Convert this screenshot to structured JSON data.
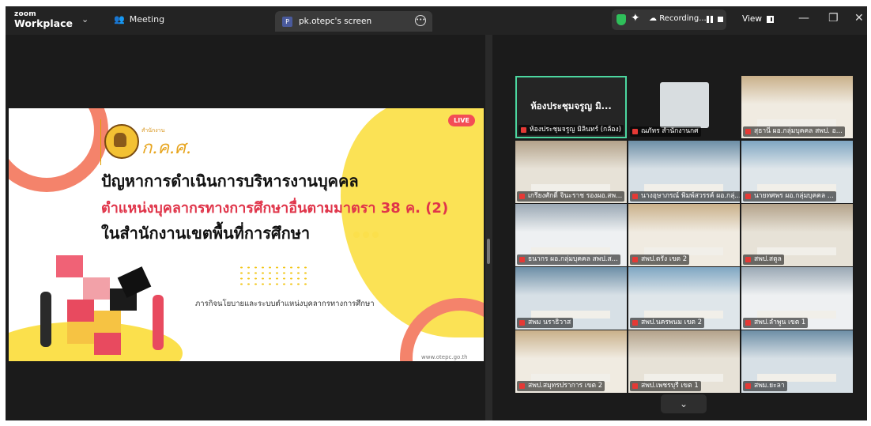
{
  "app": {
    "logo_top": "zoom",
    "logo_bottom": "Workplace",
    "meeting_label": "Meeting",
    "tab_title": "pk.otepc's screen",
    "tab_badge": "P",
    "recording_label": "Recording...",
    "view_label": "View"
  },
  "slide": {
    "live_badge": "LIVE",
    "logo_small": "สำนักงาน",
    "logo_big": "ก.ค.ศ.",
    "title_line1": "ปัญหาการดำเนินการบริหารงานบุคคล",
    "title_line2": "ตำแหน่งบุคลากรทางการศึกษาอื่นตามมาตรา 38 ค. (2)",
    "title_line3": "ในสำนักงานเขตพื้นที่การศึกษา",
    "subtitle": "ภารกิจนโยบายและระบบตำแหน่งบุคลากรทางการศึกษา",
    "url": "www.otepc.go.th"
  },
  "participants": [
    {
      "label": "ห้องประชุมจรูญ มิลินทร์ (กล้อง)",
      "display_name": "ห้องประชุมจรูญ มิ...",
      "active": true
    },
    {
      "label": "ณภัทร สำนักงานกศ",
      "display_name": ""
    },
    {
      "label": "สุธานี ผอ.กลุ่มบุคคล สพป. อ...",
      "display_name": ""
    },
    {
      "label": "เกรียงศักดิ์ จินะราช รองผอ.สพ...",
      "display_name": ""
    },
    {
      "label": "นางอุษาภรณ์ พิมพ์สวรรค์ ผอ.กลุ่...",
      "display_name": ""
    },
    {
      "label": "นายทศพร ผอ.กลุ่มบุคคล ...",
      "display_name": ""
    },
    {
      "label": "ธนากร ผอ.กลุ่มบุคคล สพป.ส...",
      "display_name": ""
    },
    {
      "label": "สพป.ตรัง เขต 2",
      "display_name": ""
    },
    {
      "label": "สพป.สตูล",
      "display_name": ""
    },
    {
      "label": "สพม นราธิวาส",
      "display_name": ""
    },
    {
      "label": "สพป.นครพนม เขต 2",
      "display_name": ""
    },
    {
      "label": "สพป.ลำพูน เขต 1",
      "display_name": ""
    },
    {
      "label": "สพป.สมุทรปราการ เขต 2",
      "display_name": ""
    },
    {
      "label": "สพป.เพชรบุรี เขต 1",
      "display_name": ""
    },
    {
      "label": "สพม.ยะลา",
      "display_name": ""
    }
  ],
  "colors": {
    "accent_active": "#4cd7a0",
    "live": "#f34c56",
    "title_red": "#e0354a",
    "yellow": "#fbe04c",
    "coral": "#f4836b"
  },
  "icons": [
    "chevron-down-icon",
    "meeting-icon",
    "more-icon",
    "shield-icon",
    "sparkle-icon",
    "cloud-icon",
    "pause-icon",
    "stop-icon",
    "view-icon",
    "minimize-icon",
    "restore-icon",
    "close-icon"
  ]
}
